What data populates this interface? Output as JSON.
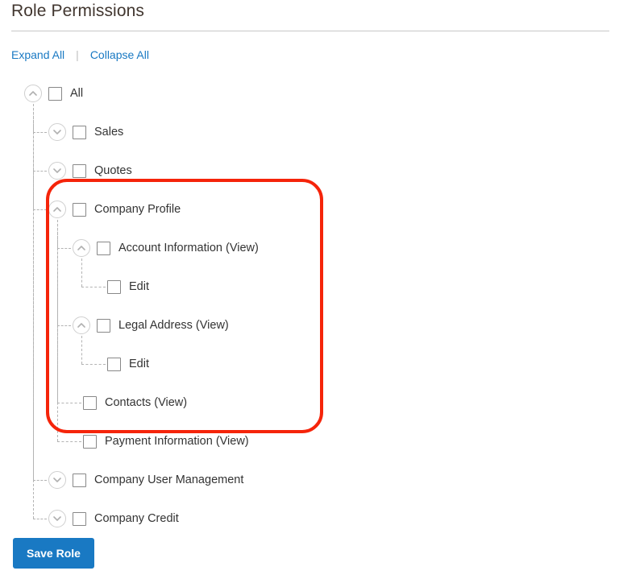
{
  "header": {
    "title": "Role Permissions"
  },
  "toolbar": {
    "expand_all_label": "Expand All",
    "collapse_all_label": "Collapse All",
    "separator": "|"
  },
  "tree": {
    "nodes": [
      {
        "label": "All",
        "level": 0,
        "toggle": "up",
        "checked": false
      },
      {
        "label": "Sales",
        "level": 1,
        "toggle": "down",
        "checked": false
      },
      {
        "label": "Quotes",
        "level": 1,
        "toggle": "down",
        "checked": false
      },
      {
        "label": "Company Profile",
        "level": 1,
        "toggle": "up",
        "checked": false
      },
      {
        "label": "Account Information (View)",
        "level": 2,
        "toggle": "up",
        "checked": false
      },
      {
        "label": "Edit",
        "level": 3,
        "toggle": "none",
        "checked": false
      },
      {
        "label": "Legal Address (View)",
        "level": 2,
        "toggle": "up",
        "checked": false
      },
      {
        "label": "Edit",
        "level": 3,
        "toggle": "none",
        "checked": false
      },
      {
        "label": "Contacts (View)",
        "level": 2,
        "toggle": "none",
        "checked": false
      },
      {
        "label": "Payment Information (View)",
        "level": 2,
        "toggle": "none",
        "checked": false
      },
      {
        "label": "Company User Management",
        "level": 1,
        "toggle": "down",
        "checked": false
      },
      {
        "label": "Company Credit",
        "level": 1,
        "toggle": "down",
        "checked": false
      }
    ]
  },
  "footer": {
    "save_label": "Save Role"
  },
  "colors": {
    "link": "#1979c3",
    "button": "#1979c3",
    "highlight": "#f5240a",
    "title": "#41362f",
    "guide": "#b3b3b3"
  },
  "icons": {
    "chevron_up": "chevron-up-icon",
    "chevron_down": "chevron-down-icon"
  }
}
